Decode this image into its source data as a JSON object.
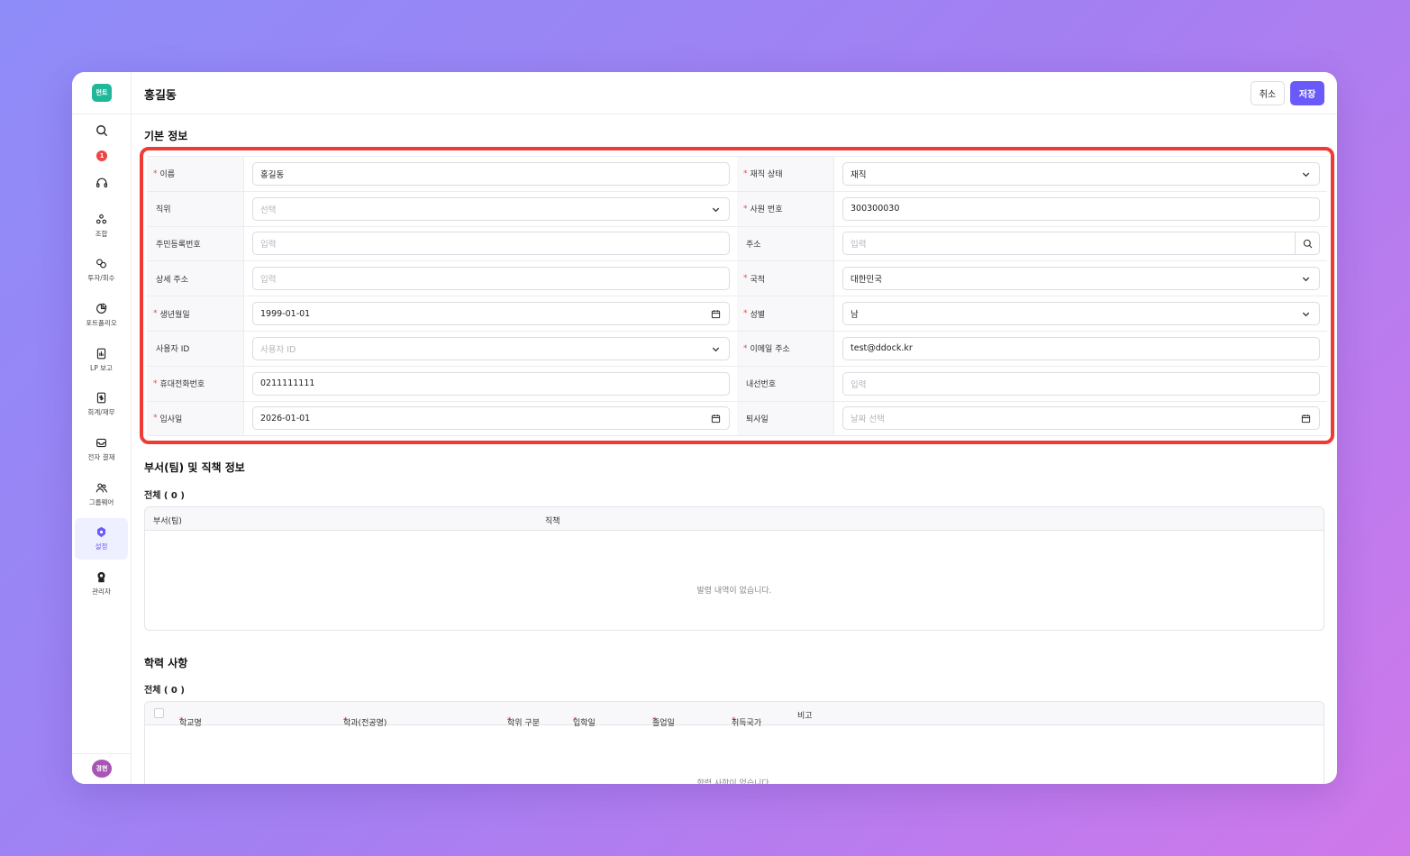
{
  "app": {
    "logo_text": "먼트",
    "notification_count": "1",
    "avatar_text": "경현"
  },
  "sidebar": {
    "items": [
      {
        "label": "조합"
      },
      {
        "label": "투자/회수"
      },
      {
        "label": "포트폴리오"
      },
      {
        "label": "LP 보고"
      },
      {
        "label": "회계/재무"
      },
      {
        "label": "전자 결재"
      },
      {
        "label": "그룹웨어"
      },
      {
        "label": "설정"
      },
      {
        "label": "관리자"
      }
    ]
  },
  "header": {
    "title": "홍길동",
    "cancel_label": "취소",
    "save_label": "저장"
  },
  "basic_info": {
    "title": "기본 정보",
    "rows": [
      {
        "l_label": "이름",
        "l_req": "*",
        "l_value": "홍길동",
        "r_label": "재직 상태",
        "r_req": "*",
        "r_value": "재직"
      },
      {
        "l_label": "직위",
        "l_req": "",
        "l_value": "선택",
        "r_label": "사원 번호",
        "r_req": "*",
        "r_value": "300300030"
      },
      {
        "l_label": "주민등록번호",
        "l_req": "",
        "l_value": "입력",
        "r_label": "주소",
        "r_req": "",
        "r_value": "입력"
      },
      {
        "l_label": "상세 주소",
        "l_req": "",
        "l_value": "입력",
        "r_label": "국적",
        "r_req": "*",
        "r_value": "대한민국"
      },
      {
        "l_label": "생년월일",
        "l_req": "*",
        "l_value": "1999-01-01",
        "r_label": "성별",
        "r_req": "*",
        "r_value": "남"
      },
      {
        "l_label": "사용자 ID",
        "l_req": "",
        "l_value": "사용자 ID",
        "r_label": "이메일 주소",
        "r_req": "*",
        "r_value": "test@ddock.kr"
      },
      {
        "l_label": "휴대전화번호",
        "l_req": "*",
        "l_value": "0211111111",
        "r_label": "내선번호",
        "r_req": "",
        "r_value": "입력"
      },
      {
        "l_label": "입사일",
        "l_req": "*",
        "l_value": "2026-01-01",
        "r_label": "퇴사일",
        "r_req": "",
        "r_value": "날짜 선택"
      }
    ]
  },
  "department": {
    "title": "부서(팀) 및 직책 정보",
    "count_label": "전체 ( 0 )",
    "columns": [
      "부서(팀)",
      "직책"
    ],
    "empty_message": "발령 내역이 없습니다."
  },
  "education": {
    "title": "학력 사항",
    "count_label": "전체 ( 0 )",
    "req_mark": "*",
    "columns": [
      "학교명",
      "학과(전공명)",
      "학위 구분",
      "입학일",
      "졸업일",
      "취득국가",
      "비고"
    ],
    "empty_message": "학력 사항이 없습니다."
  },
  "colors": {
    "accent": "#6a5af9",
    "required": "#ef4444",
    "highlight": "#ef3b36"
  }
}
